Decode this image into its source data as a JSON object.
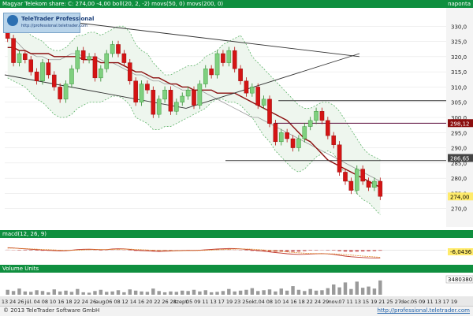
{
  "header": {
    "title": "Magyar Telekom share: C: 274,00 -4,00 boll(20, 2, -2) movs(50, 0) movs(200, 0)",
    "right_tag": "naponta"
  },
  "watermark": {
    "brand": "TeleTrader Professional",
    "url": "http://professional.teletrader.com"
  },
  "macd_panel": {
    "title": "macd(12, 26, 9)",
    "value_label": "-6,0436"
  },
  "volume_panel": {
    "title": "Volume Units",
    "value_label": "3480380"
  },
  "footer": {
    "copyright": "© 2013 TeleTrader Software GmbH",
    "url": "http://professional.teletrader.com"
  },
  "chart_data": [
    {
      "type": "candlestick",
      "series_name": "Magyar Telekom",
      "ylim": [
        265,
        335
      ],
      "y_ticks": [
        270,
        275,
        280,
        285,
        290,
        295,
        300,
        305,
        310,
        315,
        320,
        325,
        330
      ],
      "x_labels": [
        "13",
        "24",
        "26",
        "júl.",
        "04",
        "08",
        "10",
        "16",
        "18",
        "22",
        "24",
        "26",
        "aug.",
        "06",
        "08",
        "12",
        "14",
        "16",
        "20",
        "22",
        "26",
        "28",
        "szept.",
        "05",
        "09",
        "11",
        "13",
        "17",
        "19",
        "23",
        "25",
        "okt.",
        "04",
        "08",
        "10",
        "14",
        "16",
        "18",
        "22",
        "24",
        "29",
        "nov.",
        "07",
        "11",
        "13",
        "15",
        "19",
        "21",
        "25",
        "27",
        "dec.",
        "05",
        "09",
        "11",
        "13",
        "17",
        "19"
      ],
      "closes": [
        326,
        318,
        321,
        319,
        315,
        312,
        318,
        314,
        310,
        306,
        311,
        316,
        322,
        319,
        320,
        313,
        316,
        321,
        324,
        321,
        318,
        312,
        305,
        311,
        309,
        301,
        306,
        309,
        302,
        305,
        307,
        309,
        304,
        311,
        316,
        314,
        321,
        318,
        322,
        316,
        312,
        308,
        310,
        304,
        306,
        298,
        292,
        295,
        293,
        290,
        293,
        297,
        299,
        302,
        299,
        294,
        291,
        282,
        279,
        276,
        283,
        279,
        277,
        279,
        274
      ],
      "price_labels": [
        "298,12",
        "286,65",
        "274,00"
      ],
      "lines": {
        "ma50": [
          323,
          323,
          322,
          322,
          321,
          321,
          321,
          321,
          320,
          320,
          320,
          320,
          320,
          319,
          319,
          319,
          318,
          318,
          318,
          318,
          317,
          316,
          315,
          315,
          314,
          313,
          313,
          312,
          311,
          311,
          310,
          310,
          309,
          309,
          309,
          309,
          308,
          308,
          308,
          308,
          307,
          306,
          305,
          304,
          303,
          302,
          301,
          300,
          299,
          297,
          295,
          293,
          292,
          290,
          288,
          286,
          285,
          284,
          283,
          282,
          281,
          280,
          279,
          278,
          277
        ],
        "ma200": [
          326,
          326,
          324,
          322,
          321,
          320,
          320,
          319,
          319,
          319,
          320,
          321,
          321,
          320,
          320,
          320,
          319,
          318,
          318,
          317,
          316,
          315,
          314,
          314,
          313,
          312,
          312,
          311,
          311,
          310,
          309,
          309,
          309,
          309,
          308,
          307,
          306,
          305,
          304,
          303,
          302,
          301,
          300,
          300,
          299,
          298,
          297,
          296,
          295,
          294,
          293,
          292,
          291,
          290,
          289,
          288,
          287,
          286,
          285,
          284,
          283,
          282,
          281,
          280,
          279
        ],
        "boll_upper": [
          333,
          331,
          330,
          329,
          327,
          326,
          325,
          323,
          322,
          322,
          323,
          325,
          327,
          327,
          328,
          328,
          327,
          328,
          329,
          330,
          330,
          328,
          324,
          322,
          321,
          318,
          316,
          314,
          314,
          315,
          316,
          317,
          317,
          318,
          320,
          321,
          322,
          324,
          325,
          326,
          327,
          324,
          320,
          318,
          316,
          314,
          312,
          310,
          308,
          306,
          304,
          303,
          303,
          304,
          305,
          305,
          304,
          302,
          299,
          296,
          293,
          290,
          288,
          287,
          286
        ],
        "boll_lower": [
          313,
          312,
          311,
          310,
          308,
          306,
          305,
          303,
          301,
          300,
          300,
          301,
          303,
          304,
          305,
          305,
          305,
          306,
          307,
          307,
          306,
          304,
          300,
          299,
          298,
          296,
          296,
          297,
          297,
          298,
          299,
          300,
          301,
          302,
          303,
          305,
          306,
          306,
          305,
          305,
          304,
          302,
          300,
          297,
          294,
          292,
          289,
          287,
          285,
          283,
          282,
          283,
          285,
          287,
          288,
          289,
          288,
          285,
          281,
          277,
          275,
          273,
          272,
          270,
          268
        ]
      },
      "horizontal_levels": [
        305.5,
        298.1,
        285.8
      ],
      "trendlines": [
        {
          "from": [
            "13",
            333
          ],
          "to": [
            "24",
            328
          ]
        },
        {
          "from": [
            "13",
            334
          ],
          "to": [
            "15",
            320
          ]
        },
        {
          "from": [
            "13",
            314
          ],
          "to": [
            "05",
            303
          ]
        },
        {
          "from": [
            "05",
            303
          ],
          "to": [
            "15",
            321
          ]
        }
      ]
    },
    {
      "type": "line",
      "series_name": "MACD",
      "ylim": [
        -10,
        8
      ],
      "y_ticks": [],
      "values": [
        1.8,
        1.6,
        1.2,
        0.9,
        0.6,
        0.3,
        0.0,
        -0.2,
        -0.4,
        -0.6,
        -0.5,
        -0.1,
        0.4,
        0.6,
        0.7,
        0.5,
        0.3,
        0.4,
        0.8,
        1.0,
        0.9,
        0.5,
        -0.1,
        -0.4,
        -0.6,
        -0.9,
        -1.1,
        -0.9,
        -0.7,
        -0.5,
        -0.4,
        -0.2,
        -0.3,
        -0.1,
        0.2,
        0.5,
        0.8,
        1.0,
        1.2,
        1.1,
        0.9,
        0.5,
        0.1,
        -0.4,
        -0.9,
        -1.4,
        -1.9,
        -2.3,
        -2.8,
        -3.1,
        -3.3,
        -3.2,
        -3.0,
        -2.8,
        -2.7,
        -2.9,
        -3.3,
        -4.0,
        -4.6,
        -5.1,
        -5.4,
        -5.7,
        -5.9,
        -6.0,
        -6.0
      ],
      "signal": [
        1.5,
        1.4,
        1.3,
        1.1,
        0.9,
        0.7,
        0.5,
        0.3,
        0.1,
        -0.1,
        -0.2,
        -0.2,
        -0.1,
        0.1,
        0.3,
        0.4,
        0.4,
        0.4,
        0.5,
        0.6,
        0.7,
        0.7,
        0.5,
        0.3,
        0.1,
        -0.1,
        -0.3,
        -0.4,
        -0.5,
        -0.5,
        -0.5,
        -0.4,
        -0.4,
        -0.3,
        -0.2,
        0.0,
        0.2,
        0.4,
        0.6,
        0.8,
        0.9,
        0.8,
        0.7,
        0.4,
        0.1,
        -0.2,
        -0.6,
        -1.0,
        -1.4,
        -1.8,
        -2.1,
        -2.4,
        -2.6,
        -2.7,
        -2.8,
        -2.8,
        -2.9,
        -3.1,
        -3.4,
        -3.8,
        -4.2,
        -4.6,
        -4.9,
        -5.2,
        -5.5
      ],
      "histogram": [
        0.3,
        0.2,
        -0.1,
        -0.2,
        -0.3,
        -0.4,
        -0.5,
        -0.5,
        -0.5,
        -0.5,
        -0.3,
        0.1,
        0.5,
        0.5,
        0.4,
        0.1,
        -0.1,
        0.0,
        0.3,
        0.4,
        0.2,
        -0.2,
        -0.6,
        -0.7,
        -0.7,
        -0.8,
        -0.8,
        -0.5,
        -0.2,
        0.0,
        0.1,
        0.2,
        0.1,
        0.2,
        0.4,
        0.5,
        0.6,
        0.6,
        0.6,
        0.3,
        0.0,
        -0.3,
        -0.6,
        -0.8,
        -1.0,
        -1.2,
        -1.3,
        -1.3,
        -1.4,
        -1.3,
        -1.2,
        -0.8,
        -0.4,
        -0.1,
        0.1,
        -0.1,
        -0.4,
        -0.9,
        -1.2,
        -1.3,
        -1.2,
        -1.1,
        -1.0,
        -0.8,
        -0.5
      ]
    },
    {
      "type": "bar",
      "series_name": "Volume Units",
      "ylim": [
        0,
        5000000
      ],
      "values": [
        1200000,
        900000,
        1500000,
        800000,
        700000,
        1100000,
        900000,
        600000,
        1300000,
        800000,
        1000000,
        700000,
        1400000,
        600000,
        500000,
        900000,
        1200000,
        700000,
        800000,
        1100000,
        600000,
        1300000,
        1000000,
        800000,
        700000,
        1500000,
        900000,
        600000,
        800000,
        700000,
        1000000,
        900000,
        1200000,
        800000,
        1100000,
        600000,
        700000,
        900000,
        1400000,
        800000,
        1000000,
        1200000,
        1600000,
        900000,
        1100000,
        1300000,
        800000,
        1500000,
        1000000,
        2100000,
        1200000,
        900000,
        1400000,
        1000000,
        1100000,
        1600000,
        2500000,
        1800000,
        3000000,
        1400000,
        3200000,
        1700000,
        2000000,
        1500000,
        3480380
      ]
    }
  ]
}
